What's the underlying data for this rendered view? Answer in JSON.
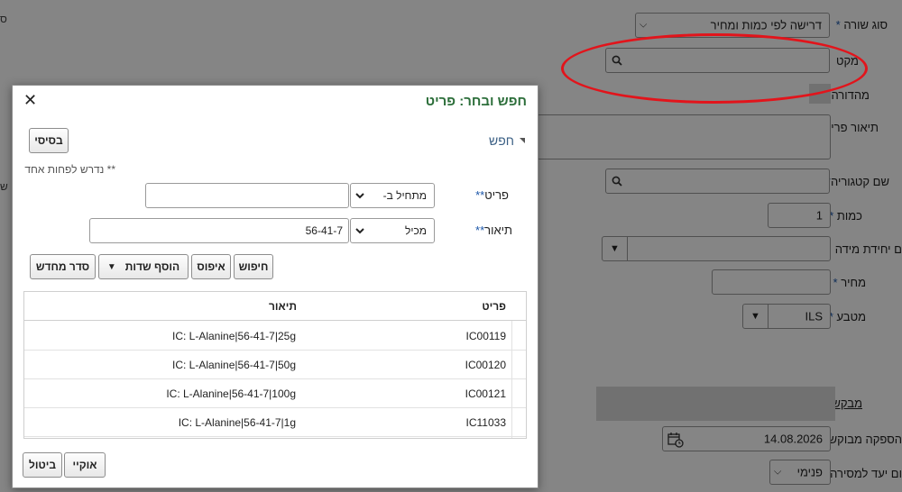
{
  "form": {
    "line_type": {
      "label": "סוג שורה",
      "value": "דרישה לפי כמות ומחיר"
    },
    "item": {
      "label": "מקט"
    },
    "revision": {
      "label": "מהדורה"
    },
    "item_description": {
      "label": "תיאור פריט"
    },
    "category_name": {
      "label": "שם קטגוריה"
    },
    "quantity": {
      "label": "כמות",
      "value": "1"
    },
    "uom_name": {
      "label": "ם יחידת מידה"
    },
    "price": {
      "label": "מחיר"
    },
    "currency": {
      "label": "מטבע",
      "value": "ILS"
    },
    "requester": {
      "label": "מבקש"
    },
    "need_by_date": {
      "label": "הספקה מבוקש",
      "value": "14.08.2026"
    },
    "deliver_to_type": {
      "label": "ום יעד למסירה",
      "value": "פנימי"
    },
    "left_edge": {
      "top": "ס",
      "mid": "ש"
    }
  },
  "dialog": {
    "title": "חפש ובחר: פריט",
    "close_symbol": "✕",
    "basic_button": "בסיסי",
    "search_header": "חפש",
    "hint": "** נדרש לפחות אחד",
    "item_row": {
      "label": "פריט",
      "required_mark": "**",
      "operator": "מתחיל ב-",
      "value": ""
    },
    "desc_row": {
      "label": "תיאור",
      "required_mark": "**",
      "operator": "מכיל",
      "value": "56-41-7"
    },
    "buttons": {
      "search": "חיפוש",
      "reset": "איפוס",
      "add_fields": "הוסף שדות",
      "reorder": "סדר מחדש"
    },
    "table": {
      "headers": {
        "item": "פריט",
        "description": "תיאור"
      },
      "rows": [
        {
          "item": "IC00119",
          "description": "IC: L-Alanine|56-41-7|25g"
        },
        {
          "item": "IC00120",
          "description": "IC: L-Alanine|56-41-7|50g"
        },
        {
          "item": "IC00121",
          "description": "IC: L-Alanine|56-41-7|100g"
        },
        {
          "item": "IC11033",
          "description": "IC: L-Alanine|56-41-7|1g"
        }
      ]
    },
    "ok_button": "אוקיי",
    "cancel_button": "ביטול"
  },
  "colors": {
    "overlay": "#000000",
    "title_green": "#2c6e3a",
    "required_blue": "#1a55a8",
    "highlight_red": "#e2141b"
  }
}
